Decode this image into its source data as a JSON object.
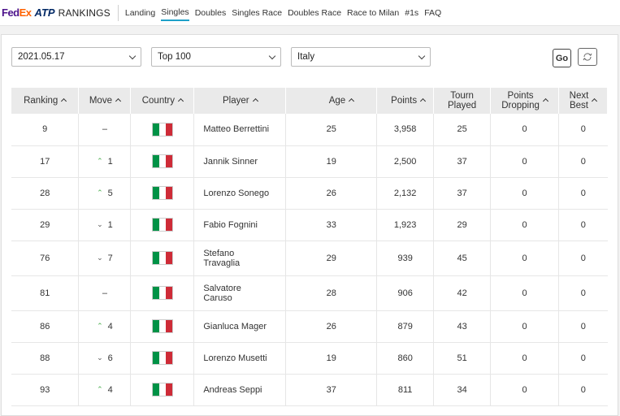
{
  "nav": {
    "logo_fed": "Fed",
    "logo_ex": "Ex",
    "logo_atp": "ATP",
    "logo_rankings": "RANKINGS",
    "links": [
      {
        "label": "Landing"
      },
      {
        "label": "Singles",
        "active": true
      },
      {
        "label": "Doubles"
      },
      {
        "label": "Singles Race"
      },
      {
        "label": "Doubles Race"
      },
      {
        "label": "Race to Milan"
      },
      {
        "label": "#1s"
      },
      {
        "label": "FAQ"
      }
    ]
  },
  "filters": {
    "date": "2021.05.17",
    "range": "Top 100",
    "country": "Italy",
    "go_label": "Go"
  },
  "table": {
    "headers": {
      "ranking": "Ranking",
      "move": "Move",
      "country": "Country",
      "player": "Player",
      "age": "Age",
      "points": "Points",
      "tourn_1": "Tourn",
      "tourn_2": "Played",
      "dropping_1": "Points",
      "dropping_2": "Dropping",
      "next_1": "Next",
      "next_2": "Best"
    },
    "rows": [
      {
        "rank": "9",
        "move_dir": "none",
        "move": "–",
        "player_1": "Matteo Berrettini",
        "player_2": "",
        "age": "25",
        "points": "3,958",
        "tourn": "25",
        "dropping": "0",
        "next": "0"
      },
      {
        "rank": "17",
        "move_dir": "up",
        "move": "1",
        "player_1": "Jannik Sinner",
        "player_2": "",
        "age": "19",
        "points": "2,500",
        "tourn": "37",
        "dropping": "0",
        "next": "0"
      },
      {
        "rank": "28",
        "move_dir": "up",
        "move": "5",
        "player_1": "Lorenzo Sonego",
        "player_2": "",
        "age": "26",
        "points": "2,132",
        "tourn": "37",
        "dropping": "0",
        "next": "0"
      },
      {
        "rank": "29",
        "move_dir": "down",
        "move": "1",
        "player_1": "Fabio Fognini",
        "player_2": "",
        "age": "33",
        "points": "1,923",
        "tourn": "29",
        "dropping": "0",
        "next": "0"
      },
      {
        "rank": "76",
        "move_dir": "down",
        "move": "7",
        "player_1": "Stefano",
        "player_2": "Travaglia",
        "age": "29",
        "points": "939",
        "tourn": "45",
        "dropping": "0",
        "next": "0"
      },
      {
        "rank": "81",
        "move_dir": "none",
        "move": "–",
        "player_1": "Salvatore",
        "player_2": "Caruso",
        "age": "28",
        "points": "906",
        "tourn": "42",
        "dropping": "0",
        "next": "0"
      },
      {
        "rank": "86",
        "move_dir": "up",
        "move": "4",
        "player_1": "Gianluca Mager",
        "player_2": "",
        "age": "26",
        "points": "879",
        "tourn": "43",
        "dropping": "0",
        "next": "0"
      },
      {
        "rank": "88",
        "move_dir": "down",
        "move": "6",
        "player_1": "Lorenzo Musetti",
        "player_2": "",
        "age": "19",
        "points": "860",
        "tourn": "51",
        "dropping": "0",
        "next": "0"
      },
      {
        "rank": "93",
        "move_dir": "up",
        "move": "4",
        "player_1": "Andreas Seppi",
        "player_2": "",
        "age": "37",
        "points": "811",
        "tourn": "34",
        "dropping": "0",
        "next": "0"
      }
    ]
  },
  "colors": {
    "flag_green": "#009246",
    "flag_white": "#ffffff",
    "flag_red": "#ce2b37",
    "accent": "#1ea0c8",
    "move_up": "#4caf50"
  }
}
